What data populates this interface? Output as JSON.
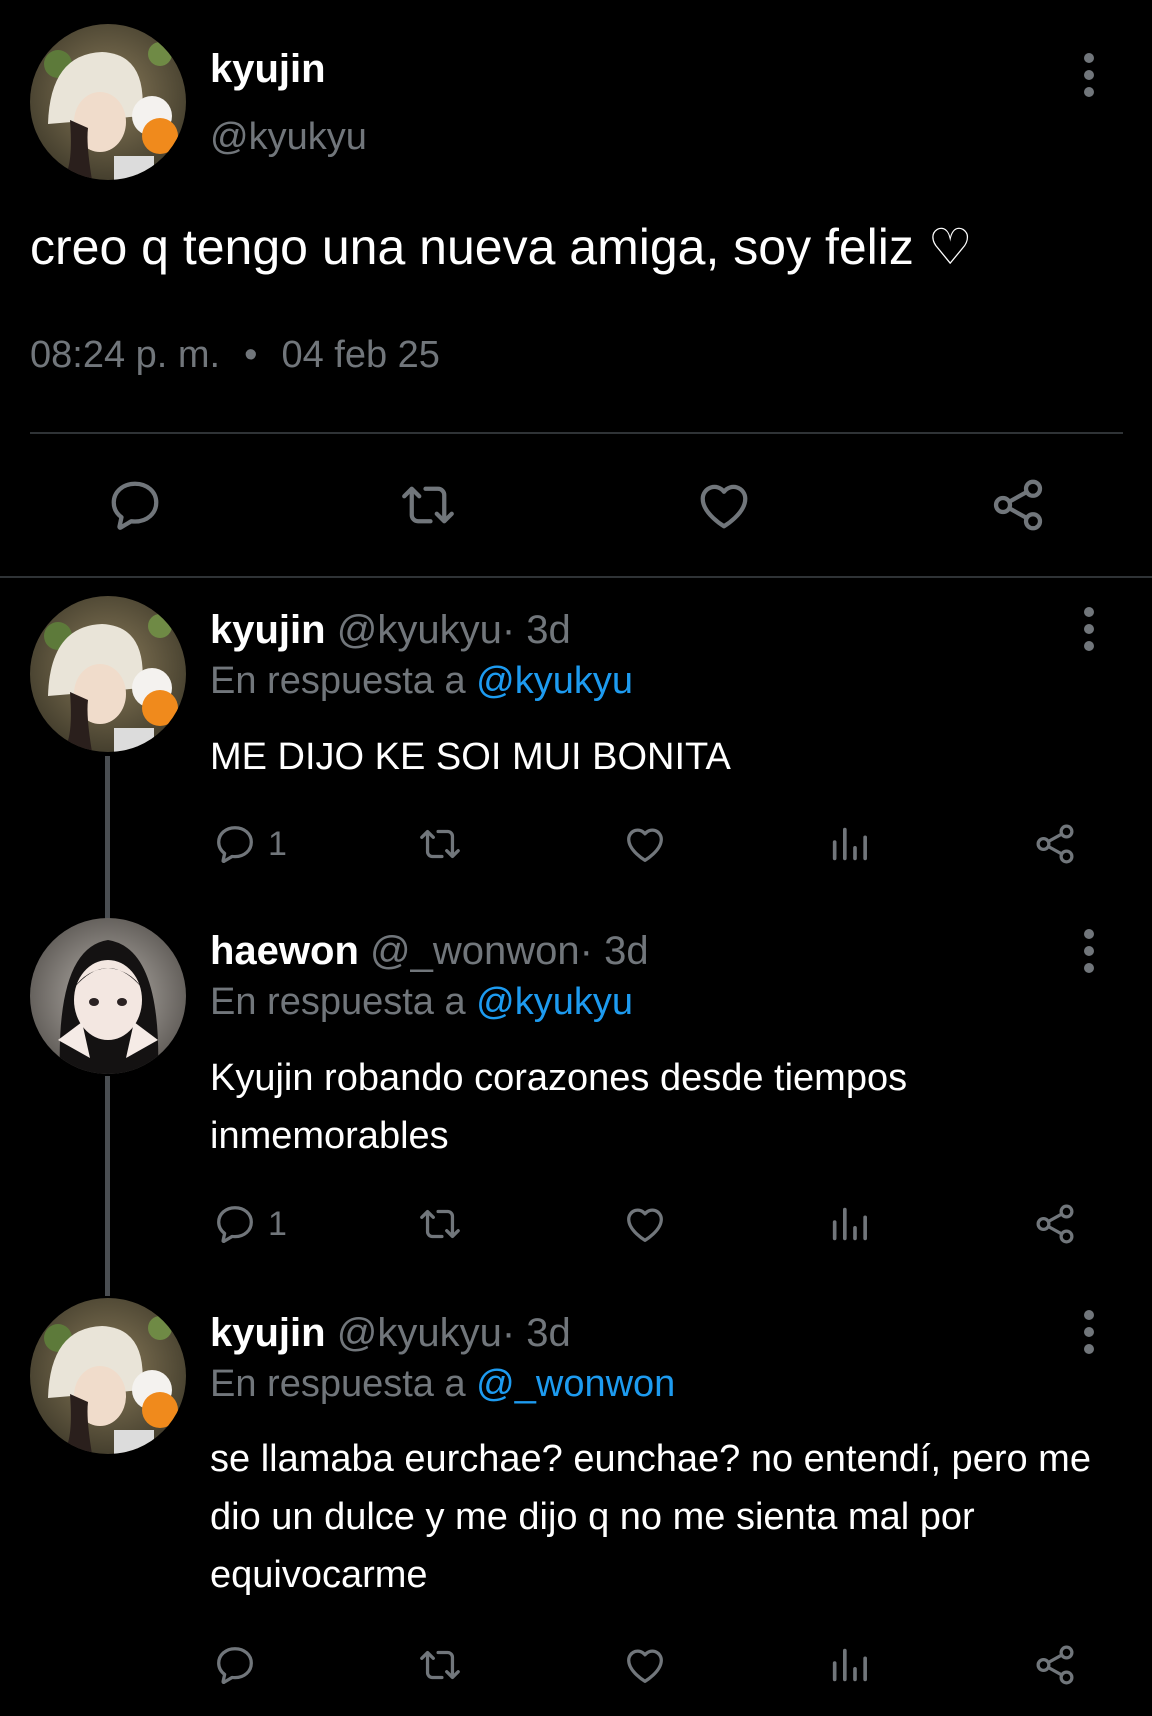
{
  "colors": {
    "background": "#000000",
    "text": "#ffffff",
    "muted": "#71767b",
    "link": "#1d9bf0",
    "divider": "#2f3336"
  },
  "main_tweet": {
    "author_name": "kyujin",
    "author_handle": "@kyukyu",
    "text": "creo q tengo una nueva amiga, soy feliz ♡",
    "time": "08:24 p. m.",
    "separator": "•",
    "date": "04 feb 25",
    "actions": [
      "reply-icon",
      "retweet-icon",
      "like-icon",
      "share-icon"
    ]
  },
  "replies": [
    {
      "name": "kyujin",
      "handle": "@kyukyu",
      "age": "· 3d",
      "reply_prefix": "En respuesta a",
      "reply_to": "@kyukyu",
      "text": "ME DIJO KE SOI MUI BONITA",
      "reply_count": "1",
      "actions": [
        "reply-icon",
        "retweet-icon",
        "like-icon",
        "views-icon",
        "share-icon"
      ]
    },
    {
      "name": "haewon",
      "handle": "@_wonwon",
      "age": "· 3d",
      "reply_prefix": "En respuesta a",
      "reply_to": "@kyukyu",
      "text": "Kyujin robando corazones desde tiempos inmemorables",
      "reply_count": "1",
      "actions": [
        "reply-icon",
        "retweet-icon",
        "like-icon",
        "views-icon",
        "share-icon"
      ]
    },
    {
      "name": "kyujin",
      "handle": "@kyukyu",
      "age": "· 3d",
      "reply_prefix": "En respuesta a",
      "reply_to": "@_wonwon",
      "text": "se llamaba eurchae? eunchae? no entendí, pero me dio un dulce y me dijo q no me sienta mal por equivocarme",
      "reply_count": "",
      "actions": [
        "reply-icon",
        "retweet-icon",
        "like-icon",
        "views-icon",
        "share-icon"
      ]
    }
  ]
}
